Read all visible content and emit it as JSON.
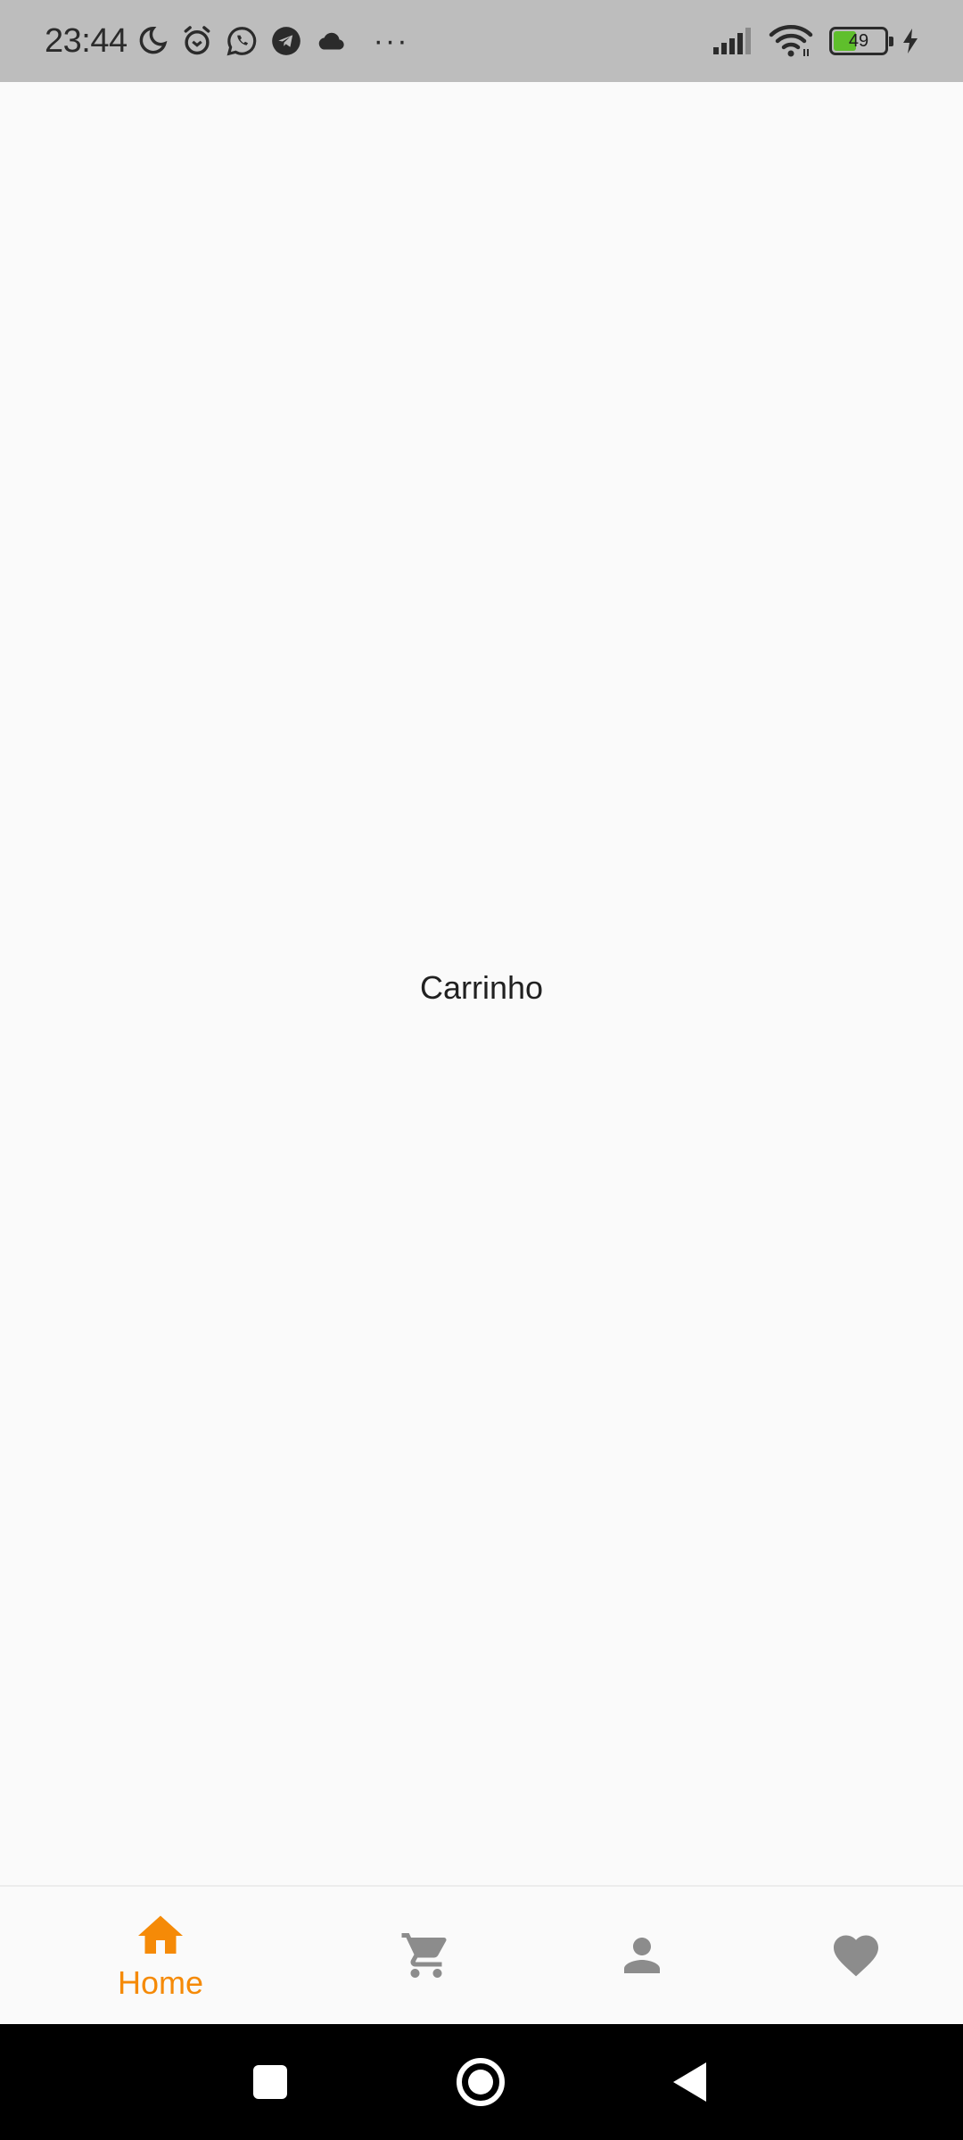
{
  "status_bar": {
    "time": "23:44",
    "left_icons": [
      "moon-icon",
      "alarm-icon",
      "whatsapp-icon",
      "telegram-icon",
      "cloud-icon"
    ],
    "overflow": "···",
    "right_icons": [
      "signal-icon",
      "wifi-icon",
      "battery-icon",
      "charging-icon"
    ],
    "battery_level": "49",
    "battery_percent": 49
  },
  "main": {
    "text": "Carrinho"
  },
  "bottom_nav": {
    "items": [
      {
        "icon": "home-icon",
        "label": "Home",
        "active": true
      },
      {
        "icon": "cart-icon",
        "label": "",
        "active": false
      },
      {
        "icon": "person-icon",
        "label": "",
        "active": false
      },
      {
        "icon": "heart-icon",
        "label": "",
        "active": false
      }
    ],
    "active_color": "#f58a07",
    "inactive_color": "#8c8c8c"
  },
  "system_nav": [
    "recents-button",
    "home-button",
    "back-button"
  ]
}
